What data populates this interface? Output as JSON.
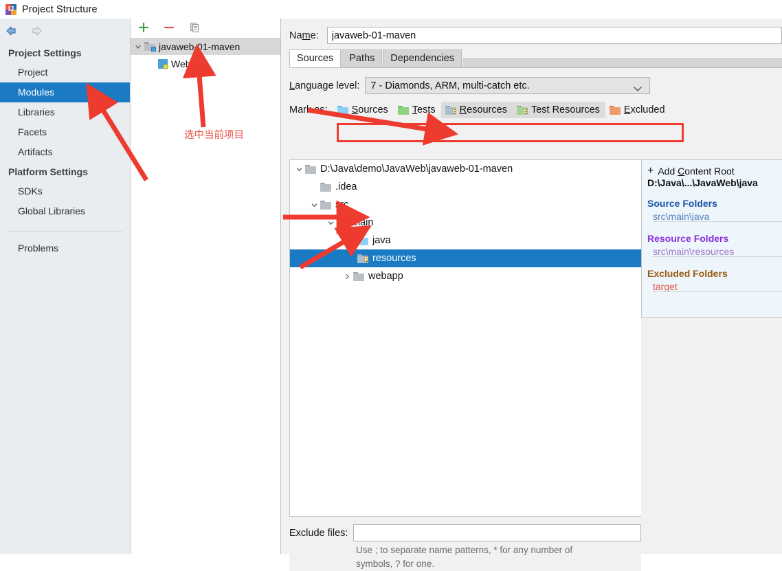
{
  "window": {
    "title": "Project Structure",
    "app_icon": "intellij-idea-icon"
  },
  "toolbar_nav": {
    "back_icon": "arrow-left-icon",
    "forward_icon": "arrow-right-icon"
  },
  "sidebar": {
    "groups": [
      {
        "title": "Project Settings",
        "items": [
          {
            "label": "Project",
            "selected": false
          },
          {
            "label": "Modules",
            "selected": true
          },
          {
            "label": "Libraries",
            "selected": false
          },
          {
            "label": "Facets",
            "selected": false
          },
          {
            "label": "Artifacts",
            "selected": false
          }
        ]
      },
      {
        "title": "Platform Settings",
        "items": [
          {
            "label": "SDKs",
            "selected": false
          },
          {
            "label": "Global Libraries",
            "selected": false
          }
        ]
      }
    ],
    "footer_items": [
      {
        "label": "Problems",
        "selected": false
      }
    ]
  },
  "module_panel": {
    "toolbar": {
      "add_label": "+",
      "remove_label": "−",
      "copy_icon": "copy-icon"
    },
    "tree": [
      {
        "label": "javaweb-01-maven",
        "expanded": true,
        "selected": true,
        "icon": "module-folder-icon",
        "depth": 0
      },
      {
        "label": "Web",
        "expanded": false,
        "selected": false,
        "icon": "web-facet-icon",
        "depth": 1
      }
    ]
  },
  "content": {
    "name_label": "Name:",
    "name_value": "javaweb-01-maven",
    "tabs": [
      {
        "label": "Sources",
        "active": true
      },
      {
        "label": "Paths",
        "active": false
      },
      {
        "label": "Dependencies",
        "active": false
      }
    ],
    "language_level_label": "Language level:",
    "language_level_value": "7 - Diamonds, ARM, multi-catch etc.",
    "mark_as_label": "Mark as:",
    "mark_as_buttons": [
      {
        "label": "Sources",
        "mnemonic": "S",
        "icon": "folder-blue-icon",
        "highlighted": false
      },
      {
        "label": "Tests",
        "mnemonic": "T",
        "icon": "folder-green-icon",
        "highlighted": false
      },
      {
        "label": "Resources",
        "mnemonic": "R",
        "icon": "folder-resource-icon",
        "highlighted": true
      },
      {
        "label": "Test Resources",
        "mnemonic": "",
        "icon": "folder-test-resource-icon",
        "highlighted": true
      },
      {
        "label": "Excluded",
        "mnemonic": "E",
        "icon": "folder-orange-icon",
        "highlighted": false
      }
    ]
  },
  "source_tree": [
    {
      "label": "D:\\Java\\demo\\JavaWeb\\javaweb-01-maven",
      "depth": 0,
      "twisty": "expanded",
      "icon": "folder-gray-icon",
      "selected": false
    },
    {
      "label": ".idea",
      "depth": 1,
      "twisty": "none",
      "icon": "folder-gray-icon",
      "selected": false
    },
    {
      "label": "src",
      "depth": 1,
      "twisty": "expanded",
      "icon": "folder-gray-icon",
      "selected": false
    },
    {
      "label": "main",
      "depth": 2,
      "twisty": "expanded",
      "icon": "folder-gray-icon",
      "selected": false
    },
    {
      "label": "java",
      "depth": 3,
      "twisty": "none",
      "icon": "folder-blue-icon",
      "selected": false
    },
    {
      "label": "resources",
      "depth": 3,
      "twisty": "none",
      "icon": "folder-resource-icon",
      "selected": true
    },
    {
      "label": "webapp",
      "depth": 2,
      "twisty": "collapsed",
      "icon": "folder-gray-icon",
      "selected": false
    }
  ],
  "info_panel": {
    "add_content_root_label": "Add Content Root",
    "add_content_root_plus": "+",
    "root_path": "D:\\Java\\...\\JavaWeb\\java",
    "sections": [
      {
        "title": "Source Folders",
        "items": [
          "src\\main\\java"
        ],
        "title_color": "#1a54a8",
        "item_color": "#5a7fbf"
      },
      {
        "title": "Resource Folders",
        "items": [
          "src\\main\\resources"
        ],
        "title_color": "#8b2fd8",
        "item_color": "#9d79c9"
      },
      {
        "title": "Excluded Folders",
        "items": [
          "target"
        ],
        "title_color": "#9a5a12",
        "item_color": "#e05a4a"
      }
    ]
  },
  "exclude": {
    "label": "Exclude files:",
    "value": "",
    "hint_line1": "Use ; to separate name patterns, * for any number of",
    "hint_line2": "symbols, ? for one."
  },
  "annotations": {
    "accent_color": "#ee3b30",
    "note_select_project": "选中当前项目",
    "arrows": [
      {
        "name": "arrow-to-modules"
      },
      {
        "name": "arrow-to-module-node"
      },
      {
        "name": "arrow-to-markas-row"
      },
      {
        "name": "arrow-to-java-folder"
      },
      {
        "name": "arrow-to-resources-folder"
      }
    ],
    "highlight_box": {
      "name": "markas-highlight-box"
    }
  },
  "colors": {
    "selection_blue": "#1a7bc4",
    "sidebar_bg": "#e9edf0",
    "panel_bg": "#f1f1f1",
    "info_bg": "#eef6fc"
  }
}
